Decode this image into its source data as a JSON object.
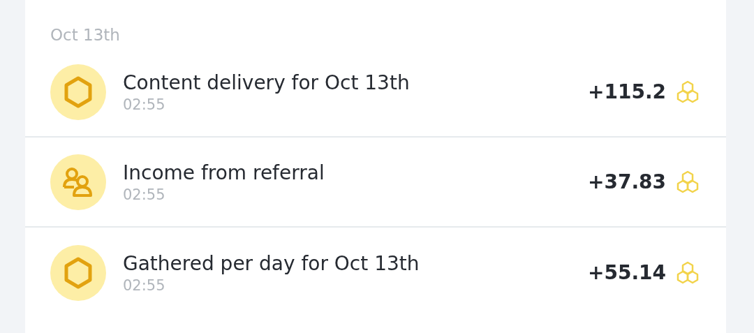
{
  "date_heading": "Oct 13th",
  "transactions": [
    {
      "kind": "hexagon",
      "title": "Content delivery for Oct 13th",
      "time": "02:55",
      "amount": "+115.2"
    },
    {
      "kind": "referral",
      "title": "Income from referral",
      "time": "02:55",
      "amount": "+37.83"
    },
    {
      "kind": "hexagon",
      "title": "Gathered per day for Oct 13th",
      "time": "02:55",
      "amount": "+55.14"
    }
  ]
}
